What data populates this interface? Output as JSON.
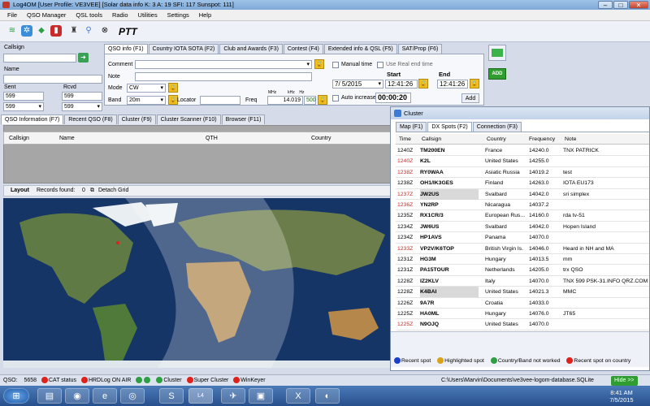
{
  "window": {
    "title": "Log4OM [User Profile: VE3VEE] [Solar data info K: 3 A: 19 SFI: 117 Sunspot: 111]",
    "minimize": "–",
    "maximize": "□",
    "close": "✕"
  },
  "menu": [
    "File",
    "QSO Manager",
    "QSL tools",
    "Radio",
    "Utilities",
    "Settings",
    "Help"
  ],
  "toolbar": {
    "ptt": "PTT"
  },
  "form": {
    "callsign_label": "Callsign",
    "name_label": "Name",
    "sent_label": "Sent",
    "rcvd_label": "Rcvd",
    "sent_value": "599",
    "rcvd_value": "599",
    "sent_combo": "599",
    "rcvd_combo": "599"
  },
  "qso_tabs": [
    "QSO info (F1)",
    "Country IOTA SOTA (F2)",
    "Club and Awards (F3)",
    "Contest (F4)",
    "Extended info & QSL (F5)",
    "SAT/Prop (F6)"
  ],
  "qso": {
    "comment_label": "Comment",
    "note_label": "Note",
    "mode_label": "Mode",
    "mode_value": "CW",
    "band_label": "Band",
    "band_value": "20m",
    "locator_label": "Locator",
    "freq_label": "Freq",
    "freq_units": "MHz          kHz    Hz",
    "freq_value": "14.019",
    "freq_hz": "500",
    "manual_time": "Manual time",
    "real_end_time": "Use Real end time",
    "start_label": "Start",
    "end_label": "End",
    "date_value": "7/ 5/2015",
    "start_time": "12:41:26",
    "end_time": "12:41:26",
    "auto_increase": "Auto increase",
    "timer": "00:00:20",
    "add_small": "Add",
    "add_button": "ADD"
  },
  "lower_tabs": [
    "QSO Information (F7)",
    "Recent QSO (F8)",
    "Cluster (F9)",
    "Cluster Scanner (F10)",
    "Browser (F11)"
  ],
  "grid_columns": [
    "Callsign",
    "Name",
    "QTH",
    "Country"
  ],
  "layout_bar": {
    "layout": "Layout",
    "records": "Records found:",
    "count": "0",
    "detach": "Detach Grid"
  },
  "cluster": {
    "title": "Cluster",
    "tabs": [
      "Map (F1)",
      "DX Spots (F2)",
      "Connection (F3)"
    ],
    "columns": [
      "Time",
      "Callsign",
      "Country",
      "Frequency",
      "Note"
    ],
    "rows": [
      {
        "time": "1240Z",
        "call": "TM200EN",
        "country": "France",
        "freq": "14240.0",
        "note": "TNX PATRICK",
        "red": false,
        "hl": false
      },
      {
        "time": "1240Z",
        "call": "K2L",
        "country": "United States",
        "freq": "14255.0",
        "note": "",
        "red": true,
        "hl": false
      },
      {
        "time": "1238Z",
        "call": "RY0WAA",
        "country": "Asiatic Russia",
        "freq": "14019.2",
        "note": "test",
        "red": true,
        "hl": false
      },
      {
        "time": "1238Z",
        "call": "OH1/IK3GES",
        "country": "Finland",
        "freq": "14263.0",
        "note": "IOTA EU173",
        "red": false,
        "hl": false
      },
      {
        "time": "1237Z",
        "call": "JW2US",
        "country": "Svalbard",
        "freq": "14042.0",
        "note": "sri simplex",
        "red": true,
        "hl": true
      },
      {
        "time": "1236Z",
        "call": "YN2RP",
        "country": "Nicaragua",
        "freq": "14037.2",
        "note": "",
        "red": true,
        "hl": false
      },
      {
        "time": "1235Z",
        "call": "RX1CR/3",
        "country": "European Rus...",
        "freq": "14160.0",
        "note": "rda tv-51",
        "red": false,
        "hl": false
      },
      {
        "time": "1234Z",
        "call": "JW6US",
        "country": "Svalbard",
        "freq": "14042.0",
        "note": "Hopen Island",
        "red": false,
        "hl": false
      },
      {
        "time": "1234Z",
        "call": "HP1AVS",
        "country": "Panama",
        "freq": "14070.0",
        "note": "",
        "red": false,
        "hl": false
      },
      {
        "time": "1233Z",
        "call": "VP2V/K6TOP",
        "country": "British Virgin Is.",
        "freq": "14046.0",
        "note": "Heard in NH and MA",
        "red": true,
        "hl": false
      },
      {
        "time": "1231Z",
        "call": "HG3M",
        "country": "Hungary",
        "freq": "14013.5",
        "note": "mm",
        "red": false,
        "hl": false
      },
      {
        "time": "1231Z",
        "call": "PA15TOUR",
        "country": "Netherlands",
        "freq": "14205.0",
        "note": "trx QSO",
        "red": false,
        "hl": false
      },
      {
        "time": "1228Z",
        "call": "IZ2KLV",
        "country": "Italy",
        "freq": "14070.0",
        "note": "TNX 599 PSK-31.INFO QRZ.COM",
        "red": false,
        "hl": false
      },
      {
        "time": "1228Z",
        "call": "K4BAI",
        "country": "United States",
        "freq": "14021.3",
        "note": "MMC",
        "red": false,
        "hl": true
      },
      {
        "time": "1226Z",
        "call": "9A7R",
        "country": "Croatia",
        "freq": "14033.0",
        "note": "",
        "red": false,
        "hl": false
      },
      {
        "time": "1225Z",
        "call": "HA0ML",
        "country": "Hungary",
        "freq": "14076.0",
        "note": "JT65",
        "red": false,
        "hl": false
      },
      {
        "time": "1225Z",
        "call": "N9OJQ",
        "country": "United States",
        "freq": "14070.0",
        "note": "",
        "red": true,
        "hl": false
      }
    ],
    "legend": [
      "Recent spot",
      "Highlighted spot",
      "Country/Band not worked",
      "Recent spot on country"
    ]
  },
  "status": {
    "qso_label": "QSO:",
    "qso_count": "5658",
    "cat": "CAT status",
    "hrdlog": "HRDLog ON AIR",
    "cluster": "Cluster",
    "super_cluster": "Super Cluster",
    "winkeyer": "WinKeyer",
    "db_path": "C:\\Users\\Marvin\\Documents\\ve3vee-logom-database.SQLite",
    "hide": "Hide >>"
  },
  "taskbar": {
    "time": "8:41 AM",
    "date": "7/5/2015"
  },
  "colors": {
    "accent_green": "#28a028",
    "spot_red": "#e0201a",
    "title_blue": "#7ea9d8"
  }
}
